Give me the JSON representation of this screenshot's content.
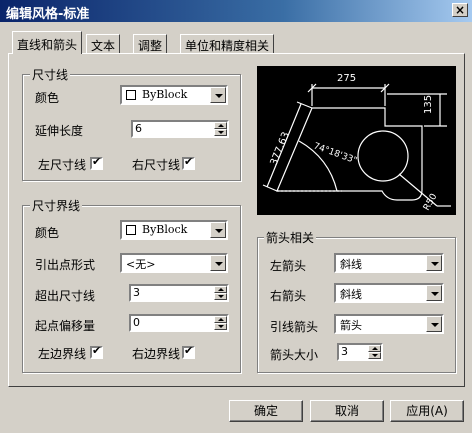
{
  "window": {
    "title": "编辑风格-标准"
  },
  "tabs": [
    {
      "label": "直线和箭头"
    },
    {
      "label": "文本"
    },
    {
      "label": "调整"
    },
    {
      "label": "单位和精度相关"
    }
  ],
  "dim_line": {
    "title": "尺寸线",
    "color_label": "颜色",
    "color_value": "ByBlock",
    "ext_len_label": "延伸长度",
    "ext_len_value": "6",
    "left_label": "左尺寸线",
    "right_label": "右尺寸线",
    "left_checked": true,
    "right_checked": true
  },
  "ext_line": {
    "title": "尺寸界线",
    "color_label": "颜色",
    "color_value": "ByBlock",
    "origin_label": "引出点形式",
    "origin_value": "<无>",
    "beyond_label": "超出尺寸线",
    "beyond_value": "3",
    "offset_label": "起点偏移量",
    "offset_value": "0",
    "left_label": "左边界线",
    "right_label": "右边界线",
    "left_checked": true,
    "right_checked": true
  },
  "arrows": {
    "title": "箭头相关",
    "left_label": "左箭头",
    "left_value": "斜线",
    "right_label": "右箭头",
    "right_value": "斜线",
    "leader_label": "引线箭头",
    "leader_value": "箭头",
    "size_label": "箭头大小",
    "size_value": "3"
  },
  "preview": {
    "dim_top": "275",
    "dim_right": "135",
    "dim_left": "377.63",
    "dim_angle": "74°18'33\"",
    "dim_radius": "R50"
  },
  "buttons": {
    "ok": "确定",
    "cancel": "取消",
    "apply": "应用(A)"
  },
  "glyphs": {
    "check": "✔",
    "close": "×"
  }
}
